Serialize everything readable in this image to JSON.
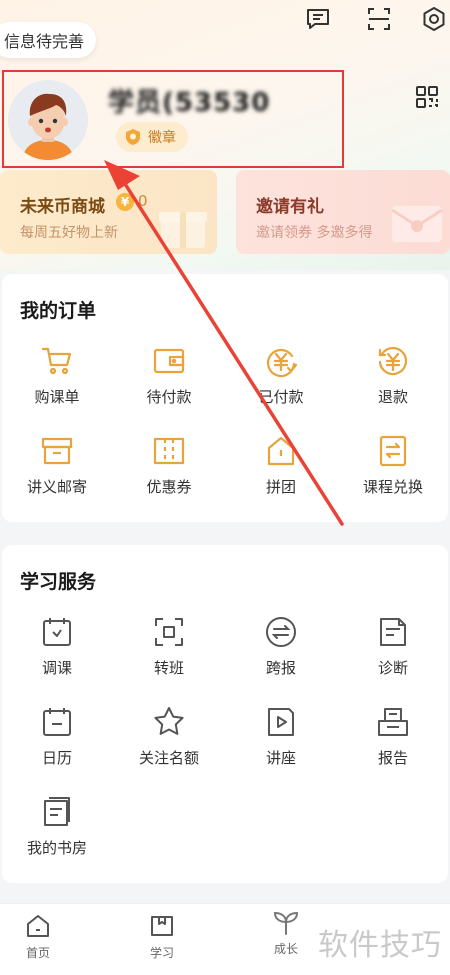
{
  "header": {
    "tooltip": "信息待完善",
    "icons": [
      "message-icon",
      "scan-icon",
      "settings-icon"
    ]
  },
  "profile": {
    "username": "学员(53530",
    "badge_label": "徽章",
    "qr_icon": "qr-code-icon"
  },
  "promos": {
    "mall": {
      "title": "未来币商城",
      "coin_count": "0",
      "subtitle": "每周五好物上新"
    },
    "invite": {
      "title": "邀请有礼",
      "subtitle": "邀请领券 多邀多得"
    }
  },
  "orders": {
    "title": "我的订单",
    "items": [
      {
        "label": "购课单",
        "icon": "cart-icon"
      },
      {
        "label": "待付款",
        "icon": "wallet-icon"
      },
      {
        "label": "已付款",
        "icon": "paid-coin-icon"
      },
      {
        "label": "退款",
        "icon": "refund-icon"
      },
      {
        "label": "讲义邮寄",
        "icon": "box-icon"
      },
      {
        "label": "优惠券",
        "icon": "coupon-icon"
      },
      {
        "label": "拼团",
        "icon": "group-icon"
      },
      {
        "label": "课程兑换",
        "icon": "exchange-icon"
      }
    ]
  },
  "services": {
    "title": "学习服务",
    "items": [
      {
        "label": "调课",
        "icon": "calendar-adjust-icon"
      },
      {
        "label": "转班",
        "icon": "transfer-icon"
      },
      {
        "label": "跨报",
        "icon": "cross-enroll-icon"
      },
      {
        "label": "诊断",
        "icon": "diagnosis-icon"
      },
      {
        "label": "日历",
        "icon": "calendar-icon"
      },
      {
        "label": "关注名额",
        "icon": "star-icon"
      },
      {
        "label": "讲座",
        "icon": "lecture-icon"
      },
      {
        "label": "报告",
        "icon": "report-icon"
      },
      {
        "label": "我的书房",
        "icon": "bookshelf-icon"
      }
    ]
  },
  "tabbar": {
    "items": [
      {
        "label": "首页",
        "icon": "home-icon"
      },
      {
        "label": "学习",
        "icon": "study-icon"
      },
      {
        "label": "成长",
        "icon": "sprout-icon"
      }
    ]
  },
  "watermark": "软件技巧",
  "colors": {
    "accent": "#e8a33a",
    "icon_gray": "#555555",
    "highlight_red": "#e53935"
  }
}
